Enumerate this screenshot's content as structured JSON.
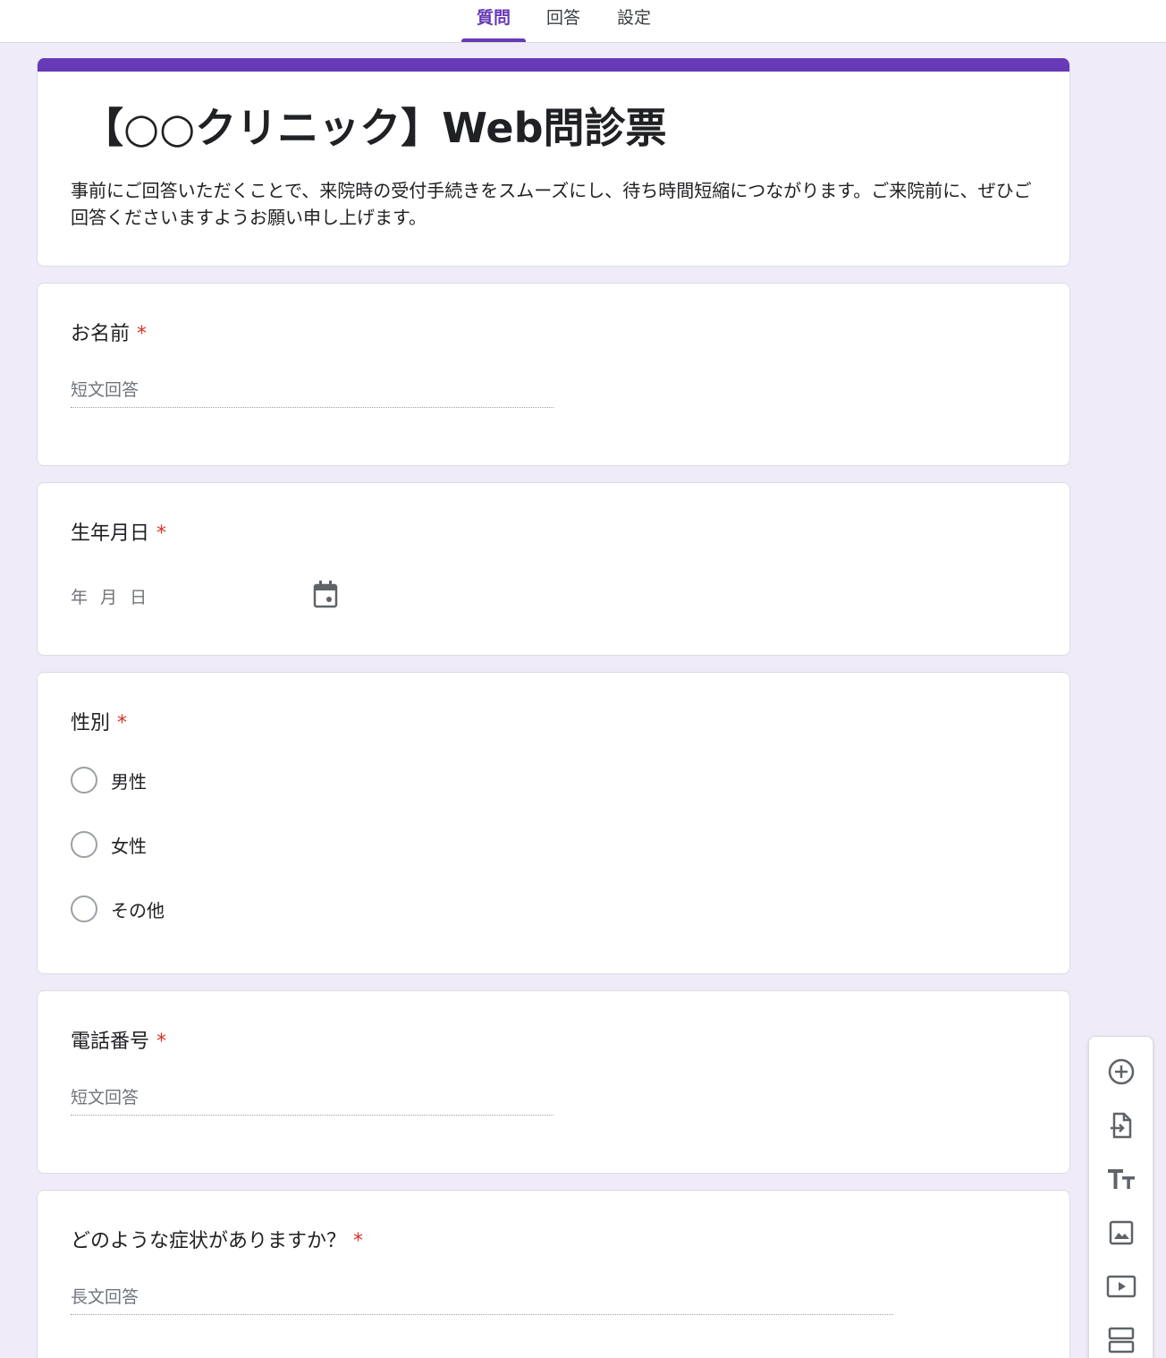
{
  "tabs": [
    {
      "label": "質問",
      "active": true
    },
    {
      "label": "回答",
      "active": false
    },
    {
      "label": "設定",
      "active": false
    }
  ],
  "form": {
    "title": "【○○クリニック】Web問診票",
    "description": "事前にご回答いただくことで、来院時の受付手続きをスムーズにし、待ち時間短縮につながります。ご来院前に、ぜひご回答くださいますようお願い申し上げます。"
  },
  "questions": {
    "name": {
      "title": "お名前",
      "required": "*",
      "placeholder": "短文回答"
    },
    "birthdate": {
      "title": "生年月日",
      "required": "*",
      "placeholder": "年 月 日"
    },
    "gender": {
      "title": "性別",
      "required": "*",
      "options": [
        "男性",
        "女性",
        "その他"
      ]
    },
    "phone": {
      "title": "電話番号",
      "required": "*",
      "placeholder": "短文回答"
    },
    "symptoms": {
      "title": "どのような症状がありますか？",
      "required": "*",
      "placeholder": "長文回答"
    }
  },
  "toolbar_icons": [
    "add-question-icon",
    "import-questions-icon",
    "add-title-icon",
    "add-image-icon",
    "add-video-icon",
    "add-section-icon"
  ],
  "colors": {
    "accent": "#673ab7",
    "background": "#f0ebf8",
    "required": "#d93025"
  }
}
